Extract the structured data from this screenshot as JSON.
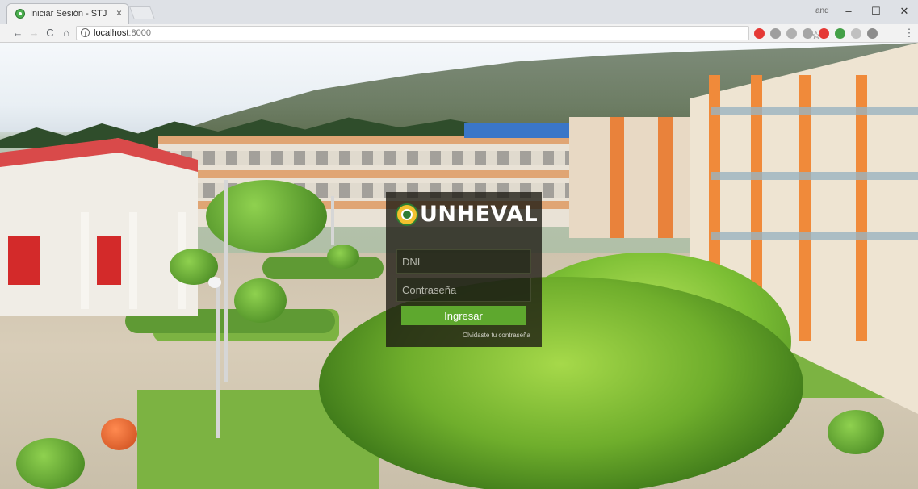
{
  "browser": {
    "tab_title": "Iniciar Sesión - STJ",
    "tab_close": "×",
    "profile_name": "and",
    "window_controls": {
      "minimize": "–",
      "maximize": "☐",
      "close": "✕"
    },
    "nav": {
      "back": "←",
      "forward": "→",
      "reload": "C",
      "home": "⌂"
    },
    "url_host": "localhost",
    "url_port": ":8000",
    "bookmark_star": "☆",
    "extensions": [
      {
        "name": "adblock-icon",
        "color": "#e53935"
      },
      {
        "name": "extension-icon-2",
        "color": "#9e9e9e"
      },
      {
        "name": "extension-icon-3",
        "color": "#b0b0b0"
      },
      {
        "name": "extension-icon-4",
        "color": "#a5a5a5"
      },
      {
        "name": "opera-icon",
        "color": "#e53935"
      },
      {
        "name": "shield-icon",
        "color": "#43a047"
      },
      {
        "name": "extension-icon-7",
        "color": "#c0c0c0"
      },
      {
        "name": "filter-icon",
        "color": "#8c8c8c"
      }
    ],
    "menu": "⋮"
  },
  "login": {
    "brand": "UNHEVAL",
    "dni_placeholder": "DNI",
    "password_placeholder": "Contraseña",
    "submit_label": "Ingresar",
    "forgot_label": "Olvidaste tu contraseña"
  },
  "colors": {
    "accent": "#5ea82e",
    "card_background": "rgba(28,26,18,0.78)"
  }
}
